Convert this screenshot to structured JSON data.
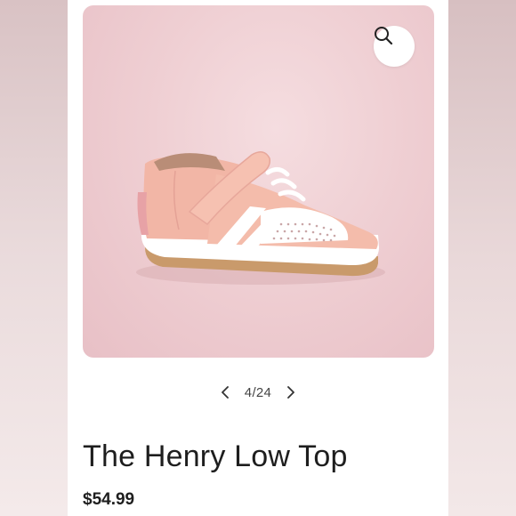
{
  "product": {
    "title": "The Henry Low Top",
    "price": "$54.99"
  },
  "gallery": {
    "counter": "4/24",
    "image_subject": "pink-leather-baby-sneaker-image",
    "prev_icon": "chevron-left-icon",
    "next_icon": "chevron-right-icon",
    "search_icon": "search-icon"
  },
  "colors": {
    "photo_bg": "#efcfd3",
    "shoe_pink": "#f2b8a8",
    "text": "#1e1e1e"
  }
}
